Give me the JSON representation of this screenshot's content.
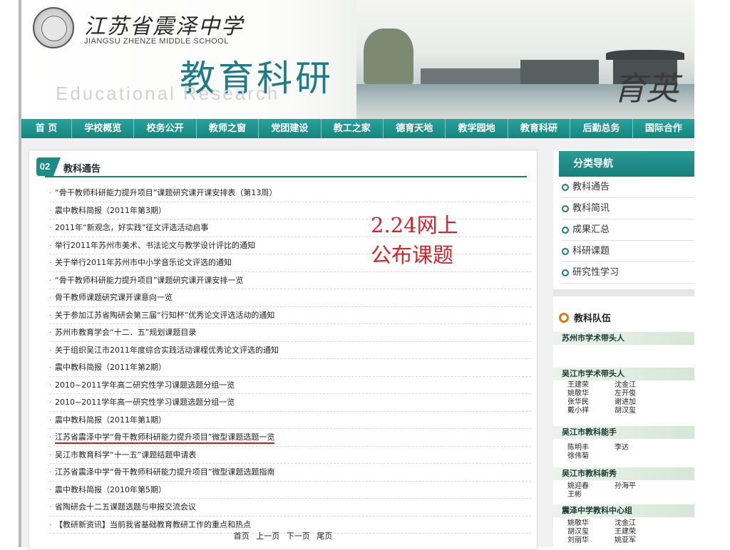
{
  "header": {
    "school_cn": "江苏省震泽中学",
    "school_en": "JIANGSU ZHENZE MIDDLE SCHOOL",
    "section_cn": "教育科研",
    "section_en": "Educational Research",
    "calligraphy": "育英"
  },
  "nav": {
    "items": [
      "首 页",
      "学校概览",
      "校务公开",
      "教师之窗",
      "党团建设",
      "教工之家",
      "德育天地",
      "教学园地",
      "教育科研",
      "后勤总务",
      "国际合作"
    ]
  },
  "main": {
    "section_number": "02",
    "section_title": "教科通告",
    "news": [
      "“骨干教师科研能力提升项目”课题研究课开课安排表（第13周）",
      "震中教科简报（2011年第3期）",
      "2011年“新观念，好实践”征文评选活动启事",
      "举行2011年苏州市美术、书法论文与教学设计评比的通知",
      "关于举行2011年苏州市中小学音乐论文评选的通知",
      "“骨干教师科研能力提升项目”课题研究课开课安排一览",
      "骨干教师课题研究课开课意向一览",
      "关于参加江苏省陶研会第三届“行知杯”优秀论文评选活动的通知",
      "苏州市教育学会“十二．五”规划课题目录",
      "关于组织吴江市2011年度综合实践活动课程优秀论文评选的通知",
      "震中教科简报（2011年第2期）",
      "2010~2011学年高二研究性学习课题选题分组一览",
      "2010~2011学年高一研究性学习课题选题分组一览",
      "震中教科简报（2011年第1期）",
      "江苏省震泽中学“骨干教师科研能力提升项目”微型课题选题一览",
      "吴江市教育科学“十一五”课题结题申请表",
      "江苏省震泽中学“骨干教师科研能力提升项目”微型课题选题指南",
      "震中教科简报（2010年第5期）",
      "省陶研会十二五课题选题与申报交流会议",
      "【教研新资讯】当前我省基础教育教研工作的重点和热点"
    ],
    "pager": [
      "首页",
      "上一页",
      "下一页",
      "尾页"
    ],
    "annotation_line1": "2.24网上",
    "annotation_line2": "公布课题"
  },
  "sidebar": {
    "nav_title": "分类导航",
    "categories": [
      "教科通告",
      "教科简讯",
      "成果汇总",
      "科研课题",
      "研究性学习"
    ],
    "team_title": "教科队伍",
    "groups": [
      {
        "title": "苏州市学术带头人",
        "names": []
      },
      {
        "title": "吴江市学术带头人",
        "names": [
          [
            "王建荣",
            "沈金江"
          ],
          [
            "姚敬华",
            "左开俊"
          ],
          [
            "张华民",
            "谢进加"
          ],
          [
            "戴小祥",
            "胡汉玺"
          ]
        ]
      },
      {
        "title": "吴江市教科能手",
        "names": [
          [
            "陈明丰",
            "李达"
          ],
          [
            "徐伟菊",
            ""
          ]
        ]
      },
      {
        "title": "吴江市教科新秀",
        "names": [
          [
            "姚迎春",
            "孙海平"
          ],
          [
            "王彬",
            ""
          ]
        ]
      },
      {
        "title": "震泽中学教科中心组",
        "names": [
          [
            "姚敬华",
            "沈金江"
          ],
          [
            "胡汉玺",
            "王建荣"
          ],
          [
            "刘丽华",
            "姚亚军"
          ]
        ]
      }
    ]
  }
}
